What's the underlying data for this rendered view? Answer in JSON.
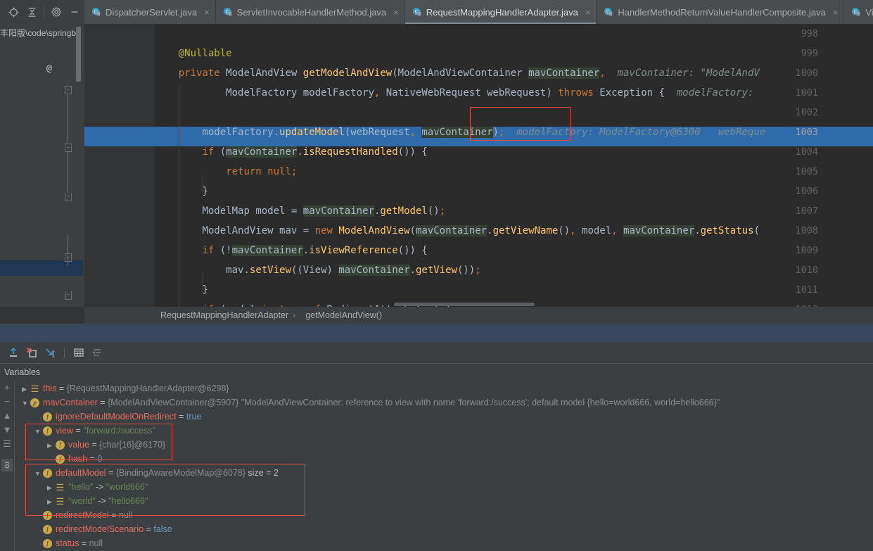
{
  "toolbar": {
    "icons": [
      {
        "name": "locate-icon",
        "glyph": "crosshair"
      },
      {
        "name": "collapse-all-icon",
        "glyph": "collapse"
      },
      {
        "name": "settings-gear-icon",
        "glyph": "gear"
      },
      {
        "name": "hide-icon",
        "glyph": "minus"
      }
    ]
  },
  "tabs": [
    {
      "label": "DispatcherServlet.java",
      "active": false
    },
    {
      "label": "ServletInvocableHandlerMethod.java",
      "active": false
    },
    {
      "label": "RequestMappingHandlerAdapter.java",
      "active": true
    },
    {
      "label": "HandlerMethodReturnValueHandlerComposite.java",
      "active": false
    },
    {
      "label": "ViewNa",
      "active": false
    }
  ],
  "project": {
    "path": "丰阳版\\code\\springb"
  },
  "editor": {
    "line_numbers": [
      "998",
      "999",
      "1000",
      "1001",
      "1002",
      "1003",
      "1004",
      "1005",
      "1006",
      "1007",
      "1008",
      "1009",
      "1010",
      "1011",
      "1012"
    ],
    "current_line": "1003",
    "gutter_annotation": "@",
    "lines": [
      {
        "no": "998",
        "code": ""
      },
      {
        "no": "999",
        "code": "    @Nullable"
      },
      {
        "no": "1000",
        "code": "    private ModelAndView getModelAndView(ModelAndViewContainer mavContainer,",
        "hint": "mavContainer: \"ModelAndV"
      },
      {
        "no": "1001",
        "code": "            ModelFactory modelFactory, NativeWebRequest webRequest) throws Exception {",
        "hint": "modelFactory:"
      },
      {
        "no": "1002",
        "code": ""
      },
      {
        "no": "1003",
        "code": "        modelFactory.updateModel(webRequest, mavContainer);",
        "hint": "modelFactory: ModelFactory@6300   webReque"
      },
      {
        "no": "1004",
        "code": "        if (mavContainer.isRequestHandled()) {"
      },
      {
        "no": "1005",
        "code": "            return null;"
      },
      {
        "no": "1006",
        "code": "        }"
      },
      {
        "no": "1007",
        "code": "        ModelMap model = mavContainer.getModel();"
      },
      {
        "no": "1008",
        "code": "        ModelAndView mav = new ModelAndView(mavContainer.getViewName(), model, mavContainer.getStatus("
      },
      {
        "no": "1009",
        "code": "        if (!mavContainer.isViewReference()) {"
      },
      {
        "no": "1010",
        "code": "            mav.setView((View) mavContainer.getView());"
      },
      {
        "no": "1011",
        "code": "        }"
      },
      {
        "no": "1012",
        "code": "        if (model instanceof RedirectAttributes) {"
      }
    ]
  },
  "breadcrumb": {
    "class_name": "RequestMappingHandlerAdapter",
    "separator": "›",
    "method_name": "getModelAndView()"
  },
  "debug_toolbar": {
    "icons": [
      {
        "name": "step-out-icon"
      },
      {
        "name": "drop-frame-icon"
      },
      {
        "name": "run-to-cursor-icon"
      },
      {
        "name": "evaluate-expression-icon"
      },
      {
        "name": "settings-list-icon"
      }
    ]
  },
  "variables": {
    "title": "Variables",
    "rail_buttons": [
      "+",
      "−",
      "▲",
      "▼",
      "≡"
    ],
    "rail_tab": "ro",
    "rows": [
      {
        "indent": 0,
        "arrow": "▶",
        "badge": "list",
        "badge_char": "☰",
        "name": "this",
        "name_class": "this",
        "eq": " = ",
        "value": "{RequestMappingHandlerAdapter@6298}",
        "value_class": "vval"
      },
      {
        "indent": 0,
        "arrow": "▼",
        "badge": "p",
        "badge_char": "p",
        "name": "mavContainer",
        "name_class": "field",
        "eq": " = ",
        "value": "{ModelAndViewContainer@5907}",
        "value_class": "vval",
        "extra": " \"ModelAndViewContainer: reference to view with name 'forward:/success'; default model {hello=world666, world=hello666}\"",
        "extra_class": "vval"
      },
      {
        "indent": 1,
        "arrow": "",
        "badge": "f",
        "badge_char": "f",
        "name": "ignoreDefaultModelOnRedirect",
        "name_class": "field",
        "eq": " = ",
        "value": "true",
        "value_class": "vbool"
      },
      {
        "indent": 1,
        "arrow": "▼",
        "badge": "f",
        "badge_char": "f",
        "name": "view",
        "name_class": "field",
        "eq": " = ",
        "value": "\"forward:/success\"",
        "value_class": "vstr"
      },
      {
        "indent": 2,
        "arrow": "▶",
        "badge": "f",
        "badge_char": "f",
        "name": "value",
        "name_class": "field",
        "eq": " = ",
        "value": "{char[16]@6170}",
        "value_class": "vval"
      },
      {
        "indent": 2,
        "arrow": "",
        "badge": "f",
        "badge_char": "f",
        "name": "hash",
        "name_class": "field",
        "eq": " = ",
        "value": "0",
        "value_class": "vbool"
      },
      {
        "indent": 1,
        "arrow": "▼",
        "badge": "f",
        "badge_char": "f",
        "name": "defaultModel",
        "name_class": "field",
        "eq": " = ",
        "value": "{BindingAwareModelMap@6078}",
        "value_class": "vval",
        "extra": "  size = 2",
        "extra_class": "vsize"
      },
      {
        "indent": 2,
        "arrow": "▶",
        "badge": "list",
        "badge_char": "☰",
        "name": "\"hello\"",
        "name_class": "str",
        "eq": " -> ",
        "value": "\"world666\"",
        "value_class": "vstr"
      },
      {
        "indent": 2,
        "arrow": "▶",
        "badge": "list",
        "badge_char": "☰",
        "name": "\"world\"",
        "name_class": "str",
        "eq": " -> ",
        "value": "\"hello666\"",
        "value_class": "vstr"
      },
      {
        "indent": 1,
        "arrow": "",
        "badge": "f",
        "badge_char": "f",
        "name": "redirectModel",
        "name_class": "field",
        "eq": " = ",
        "value": "null",
        "value_class": "vval"
      },
      {
        "indent": 1,
        "arrow": "",
        "badge": "f",
        "badge_char": "f",
        "name": "redirectModelScenario",
        "name_class": "field",
        "eq": " = ",
        "value": "false",
        "value_class": "vbool"
      },
      {
        "indent": 1,
        "arrow": "",
        "badge": "f",
        "badge_char": "f",
        "name": "status",
        "name_class": "field",
        "eq": " = ",
        "value": "null",
        "value_class": "vval"
      }
    ]
  },
  "annotations": {
    "color": "#e74a3c",
    "boxes": [
      {
        "name": "code-mavcontainer-highlight-box"
      },
      {
        "name": "view-variable-highlight-box"
      },
      {
        "name": "default-model-highlight-box"
      }
    ]
  }
}
